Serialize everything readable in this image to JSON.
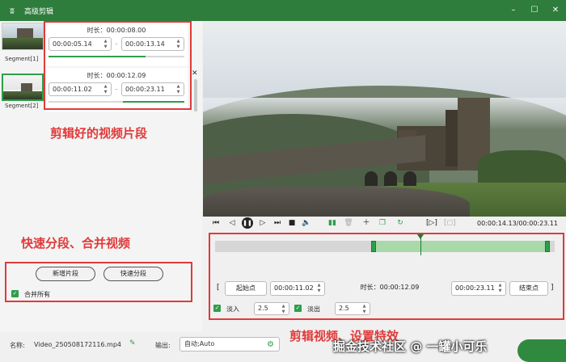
{
  "window": {
    "title": "高级剪辑"
  },
  "segments": [
    {
      "thumb_label": "Segment[1]",
      "duration_label": "时长：00:00:08.00",
      "start": "00:00:05.14",
      "end": "00:00:13.14"
    },
    {
      "thumb_label": "Segment[2]",
      "duration_label": "时长：00:00:12.09",
      "start": "00:00:11.02",
      "end": "00:00:23.11"
    }
  ],
  "left_actions": {
    "add_segment": "新增片段",
    "quick_split": "快速分段",
    "merge_all": "合并所有",
    "merge_all_checked": true
  },
  "annotations": {
    "clips_note": "剪辑好的视频片段",
    "split_note": "快速分段、合并视频",
    "clip_note": "剪辑视频、设置特效"
  },
  "player": {
    "time_readout": "00:00:14.13/00:00:23.11"
  },
  "timeline": {
    "start_btn": "起始点",
    "start_time": "00:00:11.02",
    "duration_label": "时长：00:00:12.09",
    "end_time": "00:00:23.11",
    "end_btn": "结束点",
    "fade_in_label": "淡入",
    "fade_in_value": "2.5",
    "fade_out_label": "淡出",
    "fade_out_value": "2.5",
    "selection_start_fraction": 0.479,
    "selection_end_fraction": 1.0,
    "playhead_fraction": 0.613
  },
  "bottom": {
    "name_label": "名称:",
    "name_value": "Video_250508172116.mp4",
    "output_label": "输出:",
    "output_value": "自动;Auto"
  },
  "watermark": "掘金技术社区 @ 一罐小可乐",
  "colors": {
    "titlebar": "#2f7d3c",
    "accent": "#2e9e4a",
    "annotation": "#e03a3a"
  }
}
